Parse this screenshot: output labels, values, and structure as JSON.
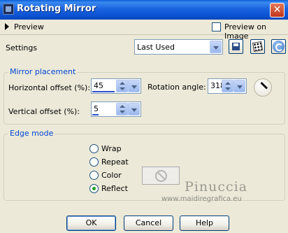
{
  "window": {
    "title": "Rotating Mirror",
    "close_glyph": "✕"
  },
  "preview": {
    "label": "Preview",
    "preview_on_image_label": "Preview on Image",
    "preview_on_image_checked": false
  },
  "settings": {
    "label": "Settings",
    "preset_value": "Last Used",
    "icons": [
      "save-preset-icon",
      "randomize-icon",
      "reset-icon"
    ]
  },
  "mirror_placement": {
    "legend": "Mirror placement",
    "horizontal_offset_label": "Horizontal offset (%):",
    "horizontal_offset_value": "45",
    "vertical_offset_label": "Vertical offset (%):",
    "vertical_offset_value": "5",
    "rotation_angle_label": "Rotation angle:",
    "rotation_angle_value": "318"
  },
  "edge_mode": {
    "legend": "Edge mode",
    "options": [
      {
        "label": "Wrap",
        "selected": false
      },
      {
        "label": "Repeat",
        "selected": false
      },
      {
        "label": "Color",
        "selected": false
      },
      {
        "label": "Reflect",
        "selected": true
      }
    ],
    "color_swatch_icon": "no-entry-icon"
  },
  "watermark": {
    "name": "Pinuccia",
    "url": "www.maidiregrafica.eu"
  },
  "buttons": {
    "ok": "OK",
    "cancel": "Cancel",
    "help": "Help"
  },
  "colors": {
    "title_bar": "#0a5fd8",
    "dialog_bg": "#ece9d8",
    "group_legend": "#0046d5",
    "slider_fill": "#2f54c8",
    "radio_selected": "#21a121"
  }
}
